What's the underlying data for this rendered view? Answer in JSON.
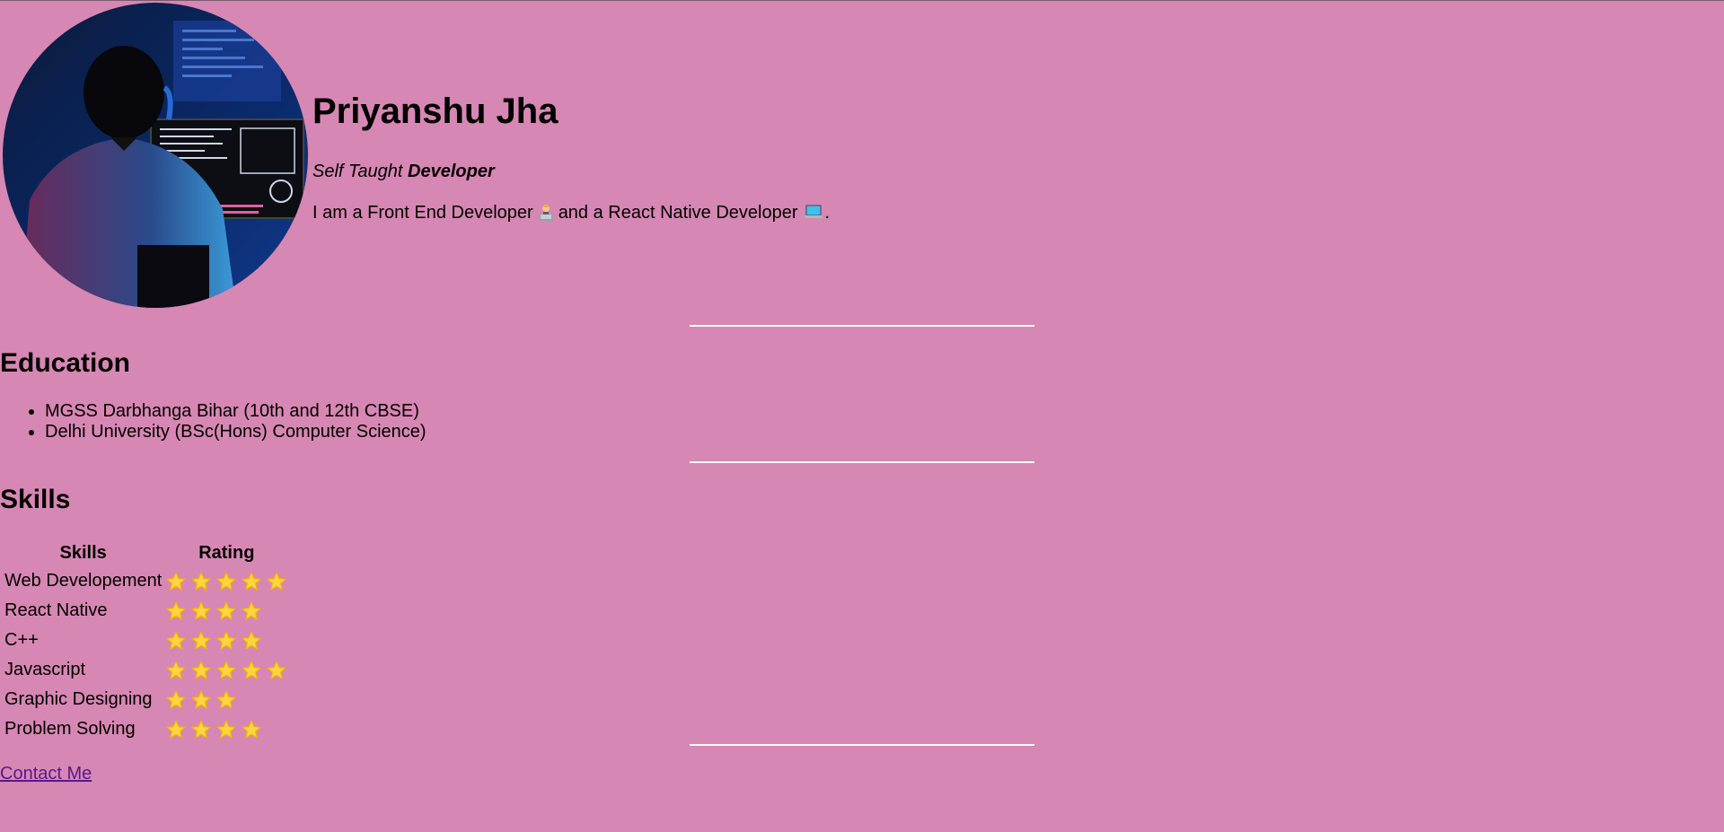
{
  "header": {
    "name": "Priyanshu Jha",
    "subtitle_italic": "Self Taught ",
    "subtitle_bold": "Developer",
    "intro_part1": "I am a Front End Developer",
    "intro_part2": "and a React Native Developer",
    "intro_end": ".",
    "icons": [
      "developer-emoji-icon",
      "laptop-emoji-icon"
    ]
  },
  "education": {
    "title": "Education",
    "items": [
      "MGSS Darbhanga Bihar (10th and 12th CBSE)",
      "Delhi University (BSc(Hons) Computer Science)"
    ]
  },
  "skills": {
    "title": "Skills",
    "headers": [
      "Skills",
      "Rating"
    ],
    "rows": [
      {
        "skill": "Web Developement",
        "rating": 5
      },
      {
        "skill": "React Native",
        "rating": 4
      },
      {
        "skill": "C++",
        "rating": 4
      },
      {
        "skill": "Javascript",
        "rating": 5
      },
      {
        "skill": "Graphic Designing",
        "rating": 3
      },
      {
        "skill": "Problem Solving",
        "rating": 4
      }
    ]
  },
  "contact": {
    "label": "Contact Me"
  },
  "colors": {
    "background": "#d787b3",
    "divider": "#ffffff",
    "star": "#fcd53f",
    "link": "#551a8b"
  }
}
